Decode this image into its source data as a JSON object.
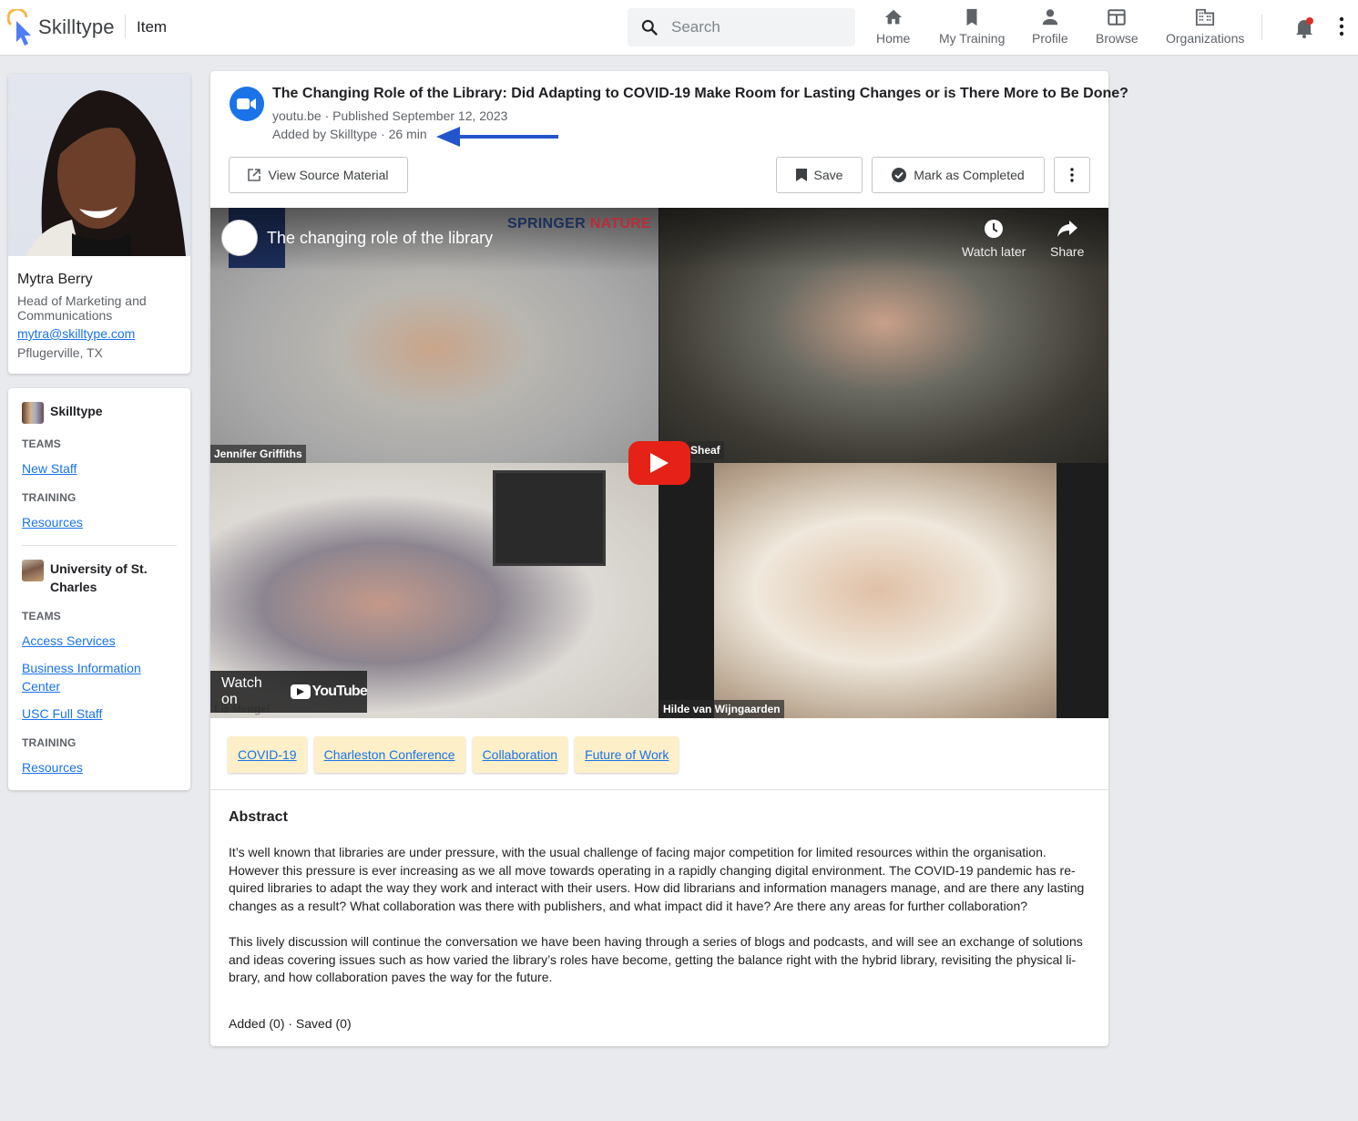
{
  "app": {
    "brand": "Skilltype",
    "page_label": "Item",
    "colors": {
      "brand_blue": "#4f7df3",
      "brand_ring": "#f2b84b",
      "link": "#1a73e8",
      "tag_bg": "#fdefc8",
      "notification_dot": "#d93025",
      "youtube_red": "#e62117"
    }
  },
  "search": {
    "placeholder": "Search",
    "value": "",
    "icon": "search-icon"
  },
  "nav": [
    {
      "label": "Home",
      "icon": "home-icon"
    },
    {
      "label": "My Training",
      "icon": "bookmark-icon"
    },
    {
      "label": "Profile",
      "icon": "person-icon"
    },
    {
      "label": "Browse",
      "icon": "browse-icon"
    },
    {
      "label": "Organizations",
      "icon": "building-icon"
    }
  ],
  "header_actions": {
    "notifications_icon": "bell-icon",
    "has_unread": true,
    "more_icon": "more-vert-icon"
  },
  "profile": {
    "name": "Mytra Berry",
    "title": "Head of Marketing and Communications",
    "email": "mytra@skilltype.com",
    "location": "Pflugerville, TX"
  },
  "orgs": [
    {
      "name": "Skilltype",
      "teams_label": "TEAMS",
      "teams": [
        "New Staff"
      ],
      "training_label": "TRAINING",
      "training": [
        "Resources"
      ]
    },
    {
      "name": "University of St. Charles",
      "teams_label": "TEAMS",
      "teams": [
        "Access Services",
        "Business Information Center",
        "USC Full Staff"
      ],
      "training_label": "TRAINING",
      "training": [
        "Resources"
      ]
    }
  ],
  "item": {
    "type_icon": "video-camera-icon",
    "title": "The Changing Role of the Library: Did Adapting to COVID-19 Make Room for Lasting Changes or is There More to Be Done?",
    "source_line": "youtu.be · Published September 12, 2023",
    "added_line": "Added by Skilltype · 26 min",
    "actions": {
      "view_source": "View Source Material",
      "save": "Save",
      "mark_completed": "Mark as Completed"
    },
    "video": {
      "title": "The changing role of the library",
      "watermark_left": "SPRINGER",
      "watermark_right": "NATURE",
      "watch_later": "Watch later",
      "share": "Share",
      "watch_on": "Watch on",
      "youtube": "YouTube",
      "participants": [
        "Jennifer Griffiths",
        "Sheaf",
        "Liz Mengel",
        "Hilde van Wijngaarden"
      ]
    },
    "tags": [
      "COVID-19",
      "Charleston Conference",
      "Collaboration",
      "Future of Work"
    ],
    "abstract_heading": "Abstract",
    "abstract_paragraphs": [
      "It’s well known that libraries are under pressure, with the usual challenge of facing major competition for limited resources within the organisation. However this pressure is ever increasing as we all move towards operating in a rapidly changing digital environment. The COVID-19 pandemic has re­quired libraries to adapt the way they work and interact with their users. How did librarians and information managers manage, and are there any lasting changes as a result? What collaboration was there with publishers, and what impact did it have? Are there any areas for further collaboration?",
      "This lively discussion will continue the conversation we have been having through a series of blogs and podcasts, and will see an exchange of solutions and ideas covering issues such as how varied the library’s roles have become, getting the balance right with the hybrid library, revisiting the physical li­brary, and how collaboration paves the way for the future."
    ],
    "stats": "Added (0) · Saved (0)"
  }
}
